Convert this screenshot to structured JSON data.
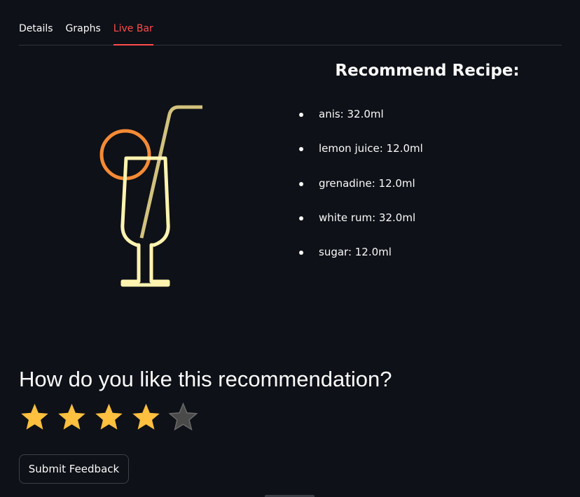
{
  "tabs": [
    {
      "label": "Details",
      "active": false
    },
    {
      "label": "Graphs",
      "active": false
    },
    {
      "label": "Live Bar",
      "active": true
    }
  ],
  "recipe": {
    "title": "Recommend Recipe:",
    "ingredients": [
      "anis: 32.0ml",
      "lemon juice: 12.0ml",
      "grenadine: 12.0ml",
      "white rum: 32.0ml",
      "sugar: 12.0ml"
    ]
  },
  "illustration": {
    "icon": "cocktail-glass-icon",
    "colors": {
      "glass": "#fff3b0",
      "straw": "#d2c27e",
      "orange_slice": "#f58a35"
    }
  },
  "feedback": {
    "question": "How do you like this recommendation?",
    "rating": 4,
    "max_rating": 5,
    "star_filled_color": "#ffbf3f",
    "star_empty_color": "#4a4a4a",
    "submit_label": "Submit Feedback"
  },
  "theme": {
    "background": "#0e1117",
    "accent": "#ff4b4b",
    "text": "#fafafa"
  }
}
